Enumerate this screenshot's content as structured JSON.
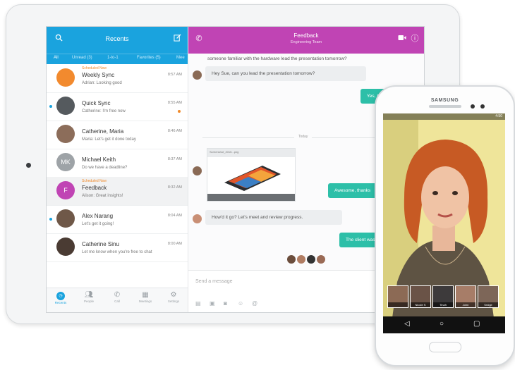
{
  "tablet": {
    "sidebar": {
      "title": "Recents",
      "filters": [
        {
          "label": "All",
          "active": true
        },
        {
          "label": "Unread (3)",
          "active": false
        },
        {
          "label": "1-to-1",
          "active": false
        },
        {
          "label": "Favorites (5)",
          "active": false
        },
        {
          "label": "Mee",
          "active": false
        }
      ],
      "conversations": [
        {
          "pre": "Scheduled Now",
          "name": "Weekly Sync",
          "message": "Adrian: Looking good",
          "time": "8:57 AM",
          "avatar_text": "",
          "avatar_color": "#f28a2e",
          "unread": false,
          "flag": false,
          "selected": false
        },
        {
          "pre": "",
          "name": "Quick Sync",
          "message": "Catherine: I'm free now",
          "time": "8:55 AM",
          "avatar_text": "",
          "avatar_color": "#555a5e",
          "unread": true,
          "flag": true,
          "selected": false
        },
        {
          "pre": "",
          "name": "Catherine, Maria",
          "message": "Maria: Let's get it done today",
          "time": "8:46 AM",
          "avatar_text": "",
          "avatar_color": "#8c6d5a",
          "unread": false,
          "flag": false,
          "selected": false
        },
        {
          "pre": "",
          "name": "Michael Keith",
          "message": "Do we have a deadline?",
          "time": "8:37 AM",
          "avatar_text": "MK",
          "avatar_color": "#9ea3a7",
          "unread": false,
          "flag": false,
          "selected": false
        },
        {
          "pre": "Scheduled Now",
          "name": "Feedback",
          "message": "Alison: Great insights!",
          "time": "8:32 AM",
          "avatar_text": "F",
          "avatar_color": "#c044b4",
          "unread": false,
          "flag": false,
          "selected": true
        },
        {
          "pre": "",
          "name": "Alex Narang",
          "message": "Let's get it going!",
          "time": "8:04 AM",
          "avatar_text": "",
          "avatar_color": "#6f5848",
          "unread": true,
          "flag": false,
          "selected": false
        },
        {
          "pre": "",
          "name": "Catherine Sinu",
          "message": "Let me know when you're free to chat",
          "time": "8:00 AM",
          "avatar_text": "",
          "avatar_color": "#4a3b33",
          "unread": false,
          "flag": false,
          "selected": false
        }
      ],
      "nav": [
        {
          "label": "Recents",
          "icon": "recents-icon",
          "active": true
        },
        {
          "label": "People",
          "icon": "people-icon",
          "active": false
        },
        {
          "label": "Call",
          "icon": "call-icon",
          "active": false
        },
        {
          "label": "Meetings",
          "icon": "meetings-icon",
          "active": false
        },
        {
          "label": "Settings",
          "icon": "settings-icon",
          "active": false
        }
      ]
    },
    "chat": {
      "title": "Feedback",
      "subtitle": "Engineering Team",
      "messages": {
        "top_partial": "someone familiar with the hardware lead the presentation tomorrow?",
        "m1": "Hey Sue, can you lead the presentation tomorrow?",
        "m2": "Yes, I can",
        "day_label": "Today",
        "attachment_caption": "Screenshot_2015...png",
        "m3": "Awesome, thanks",
        "m4": "How'd it go? Let's meet and review progress.",
        "m5": "The client was"
      },
      "compose_placeholder": "Send a message"
    }
  },
  "phone": {
    "brand": "SAMSUNG",
    "status_time": "4:50",
    "participants": [
      {
        "name": ""
      },
      {
        "name": "Nicole S"
      },
      {
        "name": "Tinah"
      },
      {
        "name": "John"
      },
      {
        "name": "Sridge"
      }
    ]
  },
  "colors": {
    "sidebar_header": "#1aa3de",
    "chat_header": "#c044b4",
    "outgoing_bubble": "#2dbfa8",
    "scheduled_text": "#f08a2a"
  }
}
